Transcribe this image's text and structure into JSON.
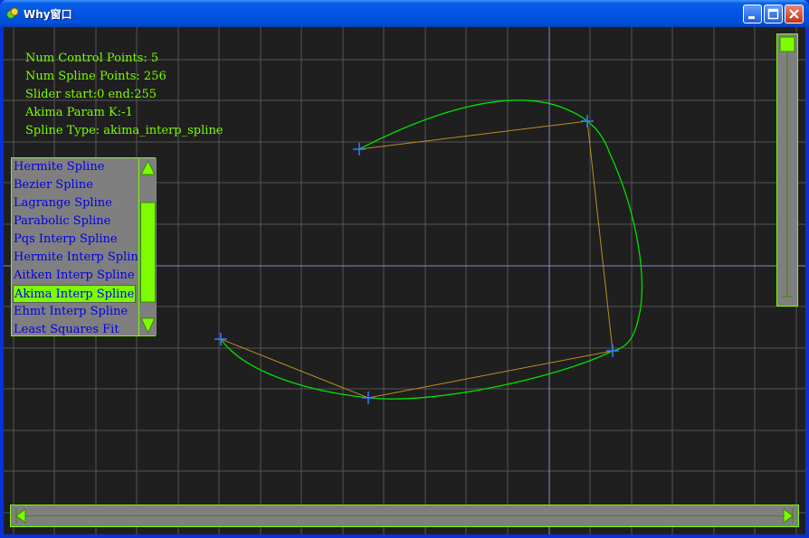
{
  "window": {
    "title": "Why窗口",
    "buttons": {
      "minimize": "minimize",
      "maximize": "maximize",
      "close": "close"
    }
  },
  "info": {
    "lines": [
      "Num Control Points: 5",
      "Num Spline Points: 256",
      "Slider start:0 end:255",
      "Akima Param K:-1",
      "Spline Type: akima_interp_spline"
    ]
  },
  "spline_list": {
    "items": [
      "Hermite Spline",
      "Bezier Spline",
      "Lagrange Spline",
      "Parabolic Spline",
      "Pqs Interp Spline",
      "Hermite Interp Spline",
      "Aitken Interp Spline",
      "Akima Interp Spline",
      "Ehmt Interp Spline",
      "Least Squares Fit"
    ],
    "selected_index": 7
  },
  "colors": {
    "background": "#1f1f1f",
    "grid": "#5a5a5a",
    "accent": "#7cfc00",
    "curve": "#00e000",
    "polygon": "#c08a2a",
    "control_point": "#3a7bff",
    "list_text": "#0000e6",
    "scroll_track": "#7f7f7f"
  },
  "sliders": {
    "vertical_level": 0,
    "horizontal_start": 0,
    "horizontal_end": 255
  }
}
